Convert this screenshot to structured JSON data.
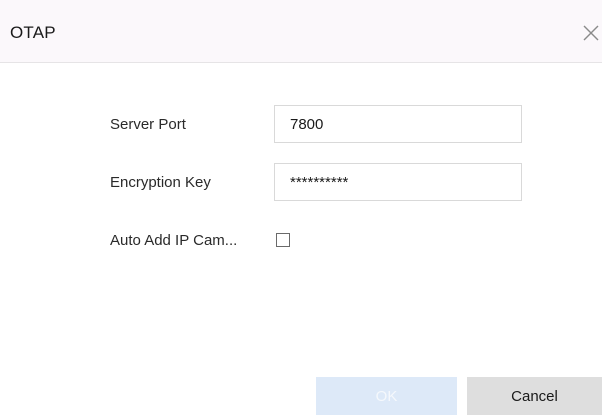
{
  "dialog": {
    "title": "OTAP",
    "close_icon": "close-icon"
  },
  "form": {
    "server_port": {
      "label": "Server Port",
      "value": "7800"
    },
    "encryption_key": {
      "label": "Encryption Key",
      "value": "**********"
    },
    "auto_add": {
      "label": "Auto Add IP Cam...",
      "checked": false
    }
  },
  "footer": {
    "ok_label": "OK",
    "cancel_label": "Cancel"
  },
  "colors": {
    "header_bg": "#fbf8fb",
    "ok_bg": "#dde9f8",
    "cancel_bg": "#dedede"
  }
}
